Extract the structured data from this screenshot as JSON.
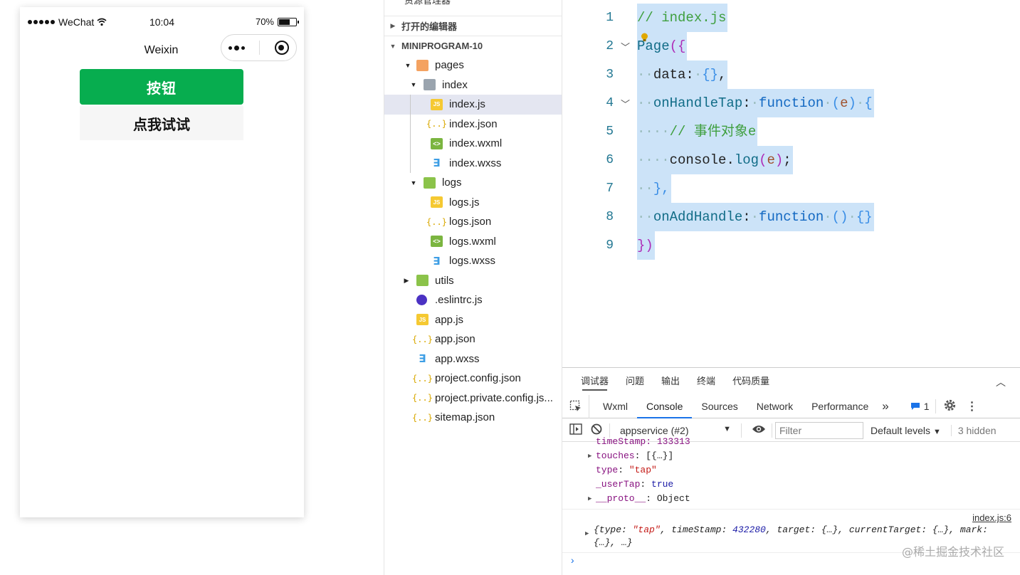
{
  "simulator": {
    "status": {
      "carrier": "WeChat",
      "time": "10:04",
      "battery_text": "70%",
      "battery_level": 0.7
    },
    "nav_title": "Weixin",
    "button_label": "按钮",
    "text_label": "点我试试"
  },
  "explorer": {
    "header": "资源管理器",
    "header_more": "···",
    "open_editors": "打开的编辑器",
    "project": "MINIPROGRAM-10",
    "tree": [
      {
        "label": "pages",
        "icon": "folder"
      },
      {
        "label": "index",
        "icon": "folder-gray"
      },
      {
        "label": "index.js",
        "icon": "js"
      },
      {
        "label": "index.json",
        "icon": "json"
      },
      {
        "label": "index.wxml",
        "icon": "wxml"
      },
      {
        "label": "index.wxss",
        "icon": "wxss"
      },
      {
        "label": "logs",
        "icon": "folder-green"
      },
      {
        "label": "logs.js",
        "icon": "js"
      },
      {
        "label": "logs.json",
        "icon": "json"
      },
      {
        "label": "logs.wxml",
        "icon": "wxml"
      },
      {
        "label": "logs.wxss",
        "icon": "wxss"
      },
      {
        "label": "utils",
        "icon": "folder-green"
      },
      {
        "label": ".eslintrc.js",
        "icon": "eslint"
      },
      {
        "label": "app.js",
        "icon": "js"
      },
      {
        "label": "app.json",
        "icon": "json"
      },
      {
        "label": "app.wxss",
        "icon": "wxss"
      },
      {
        "label": "project.config.json",
        "icon": "json"
      },
      {
        "label": "project.private.config.js...",
        "icon": "json"
      },
      {
        "label": "sitemap.json",
        "icon": "json"
      }
    ]
  },
  "editor": {
    "lines": [
      {
        "no": "1",
        "comment": "// index.js"
      },
      {
        "no": "2",
        "id": "Page",
        "open": "({"
      },
      {
        "no": "3",
        "prop": "data",
        "rest": "{}"
      },
      {
        "no": "4",
        "prop": "onHandleTap",
        "kw": "function",
        "param": "e"
      },
      {
        "no": "5",
        "comment": "// 事件对象e"
      },
      {
        "no": "6",
        "obj": "console",
        "method": "log",
        "param": "e"
      },
      {
        "no": "7",
        "close": "},"
      },
      {
        "no": "8",
        "prop": "onAddHandle",
        "kw": "function"
      },
      {
        "no": "9",
        "close": "})"
      }
    ]
  },
  "devtools": {
    "top_tabs": [
      "调试器",
      "问题",
      "输出",
      "终端",
      "代码质量"
    ],
    "tabs": [
      "Wxml",
      "Console",
      "Sources",
      "Network",
      "Performance"
    ],
    "more_tabs": "»",
    "issues_count": "1",
    "context": "appservice (#2)",
    "filter_placeholder": "Filter",
    "levels": "Default levels",
    "hidden": "3 hidden",
    "console": {
      "partial_line": "timeStamp: 133313",
      "touches_key": "touches",
      "touches_val": "[{…}]",
      "type_key": "type",
      "type_val": "\"tap\"",
      "usertap_key": "_userTap",
      "usertap_val": "true",
      "proto_key": "__proto__",
      "proto_val": "Object",
      "source": "index.js:6",
      "log_prefix": "{type: ",
      "log_type": "\"tap\"",
      "log_mid": ", timeStamp: ",
      "log_ts": "432280",
      "log_rest": ", target: {…}, currentTarget: {…}, mark: {…}, …}",
      "prompt": "›"
    },
    "watermark": "@稀土掘金技术社区"
  }
}
